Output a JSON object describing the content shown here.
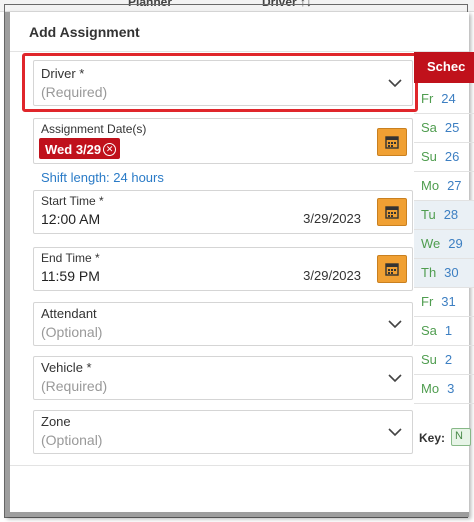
{
  "background": {
    "columns": [
      "Planner",
      "Driver ↑↓"
    ]
  },
  "modal": {
    "title": "Add Assignment",
    "driver": {
      "label": "Driver *",
      "placeholder": "(Required)"
    },
    "assignment_dates": {
      "label": "Assignment Date(s)",
      "chip": "Wed 3/29"
    },
    "shift_length": "Shift length: 24 hours",
    "start_time": {
      "label": "Start Time *",
      "time": "12:00 AM",
      "date": "3/29/2023"
    },
    "end_time": {
      "label": "End Time *",
      "time": "11:59 PM",
      "date": "3/29/2023"
    },
    "attendant": {
      "label": "Attendant",
      "placeholder": "(Optional)"
    },
    "vehicle": {
      "label": "Vehicle *",
      "placeholder": "(Required)"
    },
    "zone": {
      "label": "Zone",
      "placeholder": "(Optional)"
    }
  },
  "schedule": {
    "header": "Schec",
    "days": [
      {
        "name": "Fr",
        "date": "24"
      },
      {
        "name": "Sa",
        "date": "25"
      },
      {
        "name": "Su",
        "date": "26"
      },
      {
        "name": "Mo",
        "date": "27"
      },
      {
        "name": "Tu",
        "date": "28"
      },
      {
        "name": "We",
        "date": "29"
      },
      {
        "name": "Th",
        "date": "30"
      },
      {
        "name": "Fr",
        "date": "31"
      },
      {
        "name": "Sa",
        "date": "1"
      },
      {
        "name": "Su",
        "date": "2"
      },
      {
        "name": "Mo",
        "date": "3"
      }
    ],
    "key_label": "Key:",
    "key_box": "N"
  },
  "colors": {
    "accent_red": "#c0111b",
    "highlight_red": "#e0262b",
    "calendar_button": "#f0a033",
    "link_blue": "#2a7bc7",
    "day_green": "#4f9d4f"
  },
  "icons": {
    "dropdown": "chevron-down-icon",
    "calendar": "calendar-icon",
    "chip_remove": "close-circle-icon"
  }
}
